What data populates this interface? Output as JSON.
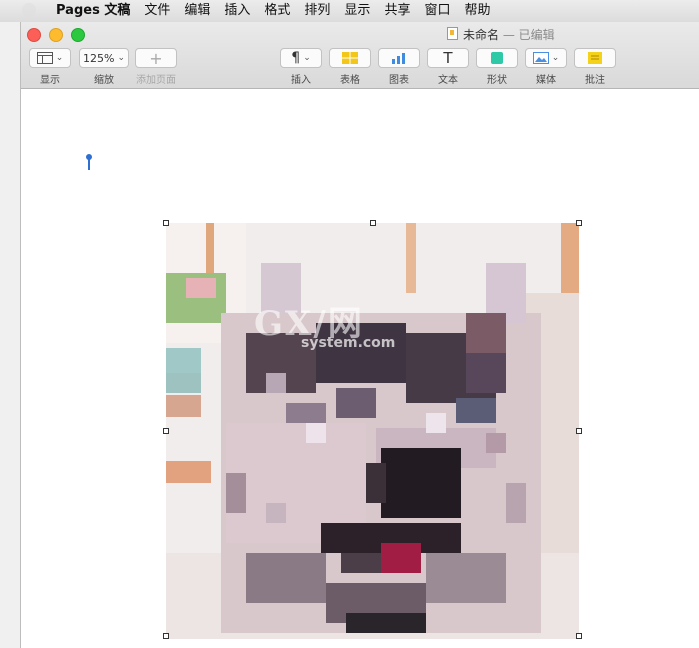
{
  "menubar": {
    "items": [
      "Pages 文稿",
      "文件",
      "编辑",
      "插入",
      "格式",
      "排列",
      "显示",
      "共享",
      "窗口",
      "帮助"
    ]
  },
  "window": {
    "title": "未命名",
    "title_separator": "—",
    "status": "已编辑"
  },
  "toolbar": {
    "view_label": "显示",
    "zoom_value": "125%",
    "zoom_label": "缩放",
    "add_page_label": "添加页面",
    "insert_label": "插入",
    "table_label": "表格",
    "chart_label": "图表",
    "text_label": "文本",
    "shape_label": "形状",
    "media_label": "媒体",
    "comment_label": "批注",
    "insert_glyph": "¶",
    "text_glyph": "T",
    "add_page_glyph": "+"
  },
  "colors": {
    "table_icon": "#f2c71a",
    "chart_icon": "#3f8be0",
    "shape_icon": "#2ec9a6",
    "media_icon": "#4a90e2",
    "comment_icon": "#f4d21a"
  },
  "watermark": {
    "main": "GX/网",
    "sub": "system.com"
  }
}
